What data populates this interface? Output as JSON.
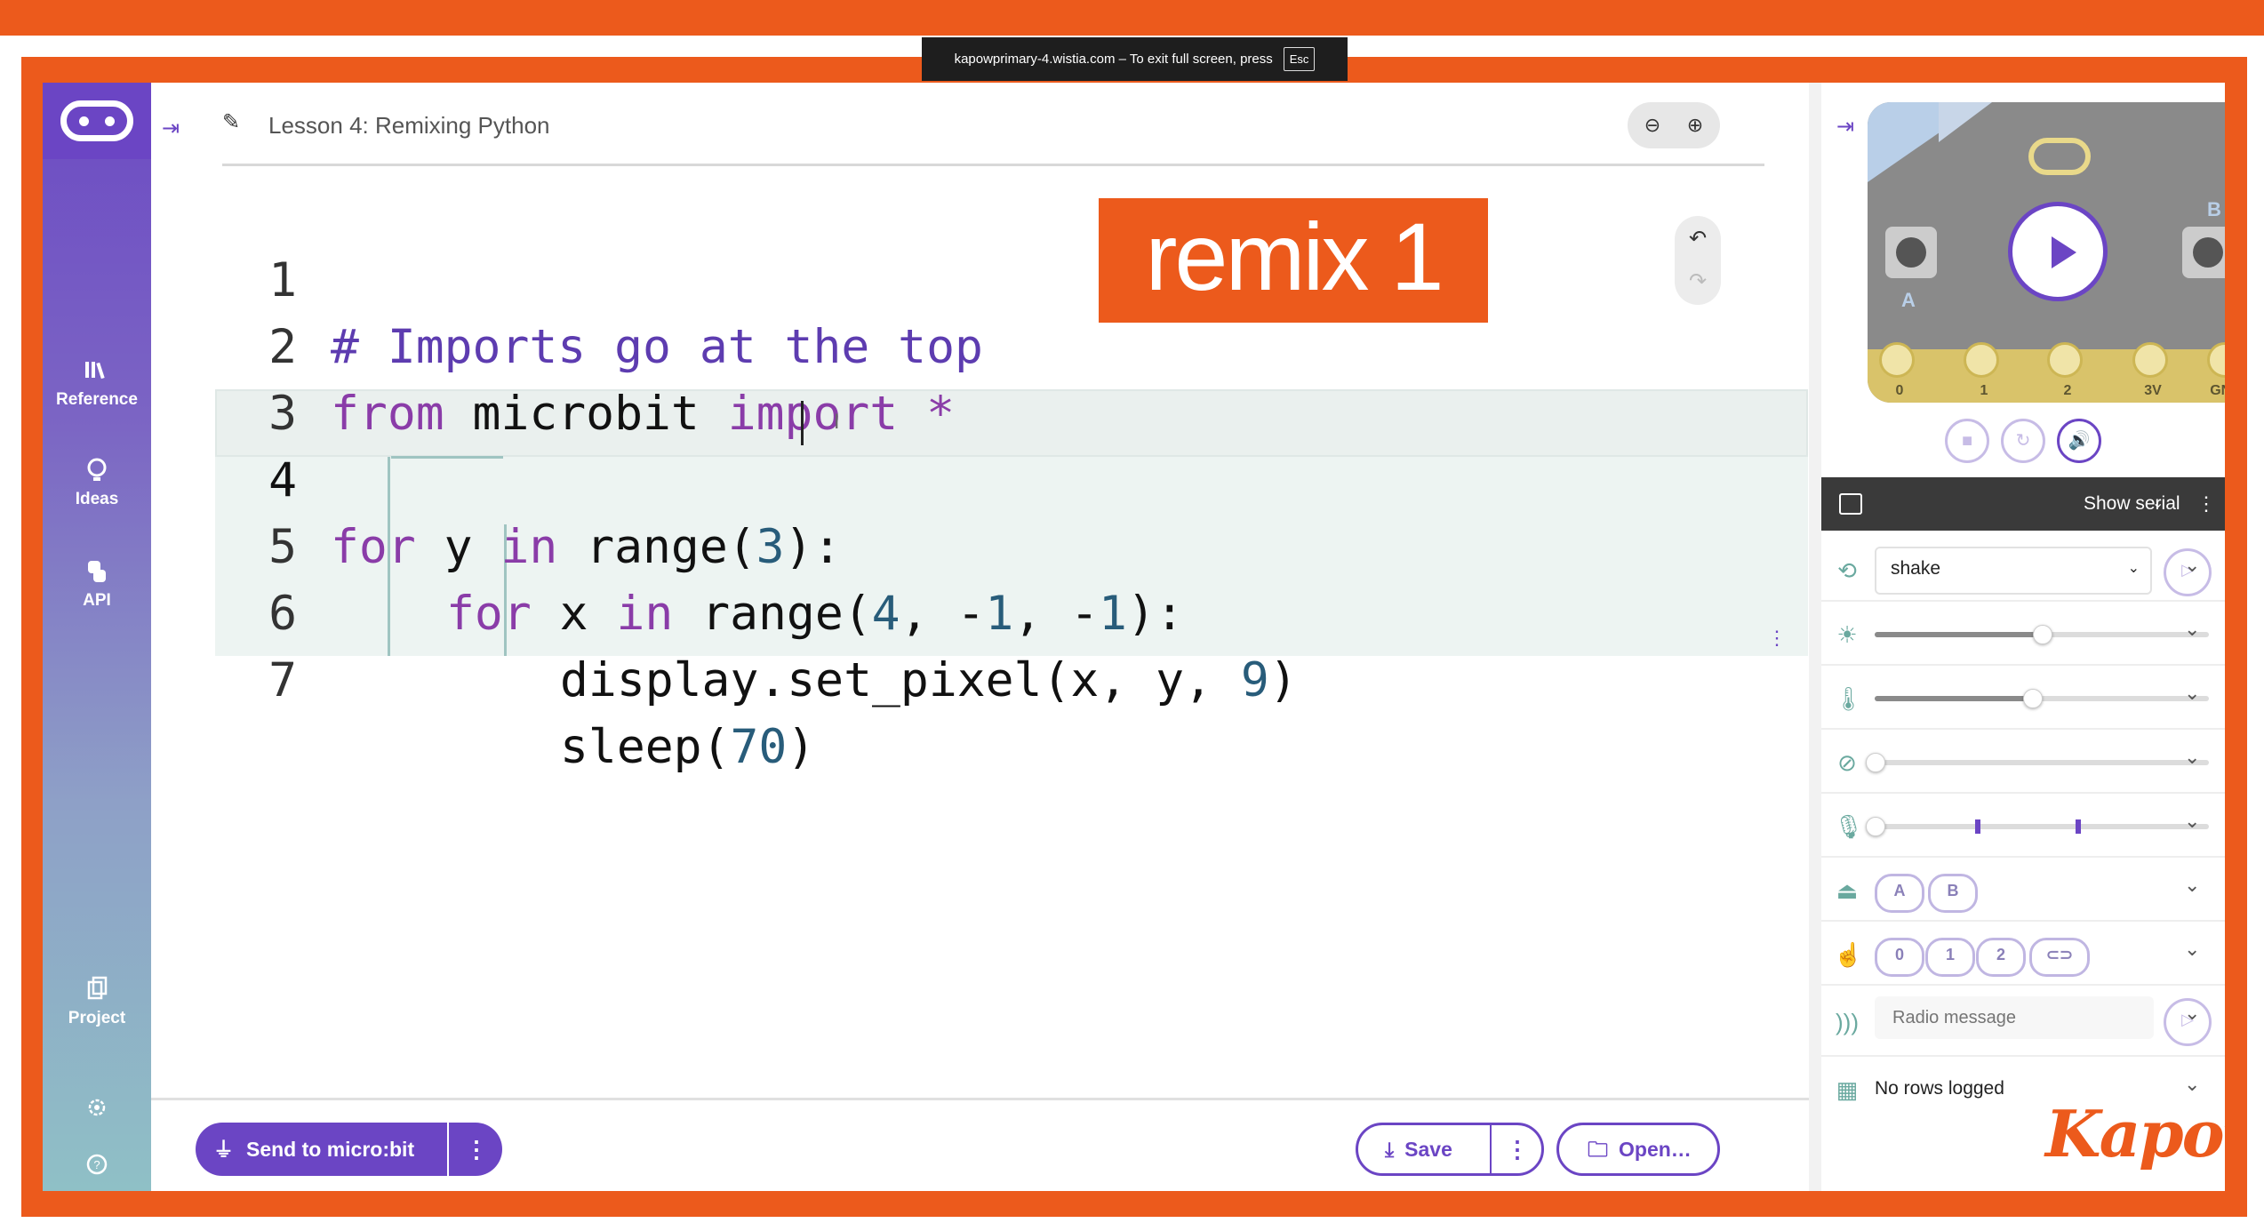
{
  "browser": {
    "fullscreen_notice": "kapowprimary-4.wistia.com – To exit full screen, press",
    "esc_key": "Esc"
  },
  "sidebar": {
    "items": [
      {
        "label": "Reference",
        "icon": "books-icon"
      },
      {
        "label": "Ideas",
        "icon": "lightbulb-icon"
      },
      {
        "label": "API",
        "icon": "python-icon"
      },
      {
        "label": "Project",
        "icon": "files-icon"
      }
    ]
  },
  "editor": {
    "project_name": "Lesson 4: Remixing Python",
    "active_line": 4,
    "lines": [
      {
        "num": "1",
        "code": "# Imports go at the top"
      },
      {
        "num": "2",
        "code": "from microbit import *"
      },
      {
        "num": "3",
        "code": ""
      },
      {
        "num": "4",
        "code": "for y in range(3):"
      },
      {
        "num": "5",
        "code": "for x in range(4, -1, -1):"
      },
      {
        "num": "6",
        "code": "display.set_pixel(x, y, 9)"
      },
      {
        "num": "7",
        "code": "sleep(70)"
      }
    ],
    "overlay_banner": "remix 1"
  },
  "toolbar": {
    "send_label": "Send to micro:bit",
    "more_symbol": "⋮",
    "save_label": "Save",
    "open_label": "Open…"
  },
  "simulator": {
    "pins": [
      "0",
      "1",
      "2",
      "3V",
      "GND"
    ],
    "button_a": "A",
    "button_b": "B",
    "serial_label": "Show serial",
    "gesture_value": "shake",
    "accent": "#6b45c4",
    "brightness_level": 0.5,
    "temperature_level": 0.47,
    "compass_level": 0.0,
    "sound_level": 0.0,
    "sound_marks": [
      0.3,
      0.6
    ],
    "buttons": [
      "A",
      "B"
    ],
    "touch_pins": [
      "0",
      "1",
      "2"
    ],
    "radio_placeholder": "Radio message",
    "data_log_text": "No rows logged"
  },
  "branding": {
    "kapow_logo": "Kapow",
    "tm": "™",
    "orange": "#ec5a1c"
  }
}
